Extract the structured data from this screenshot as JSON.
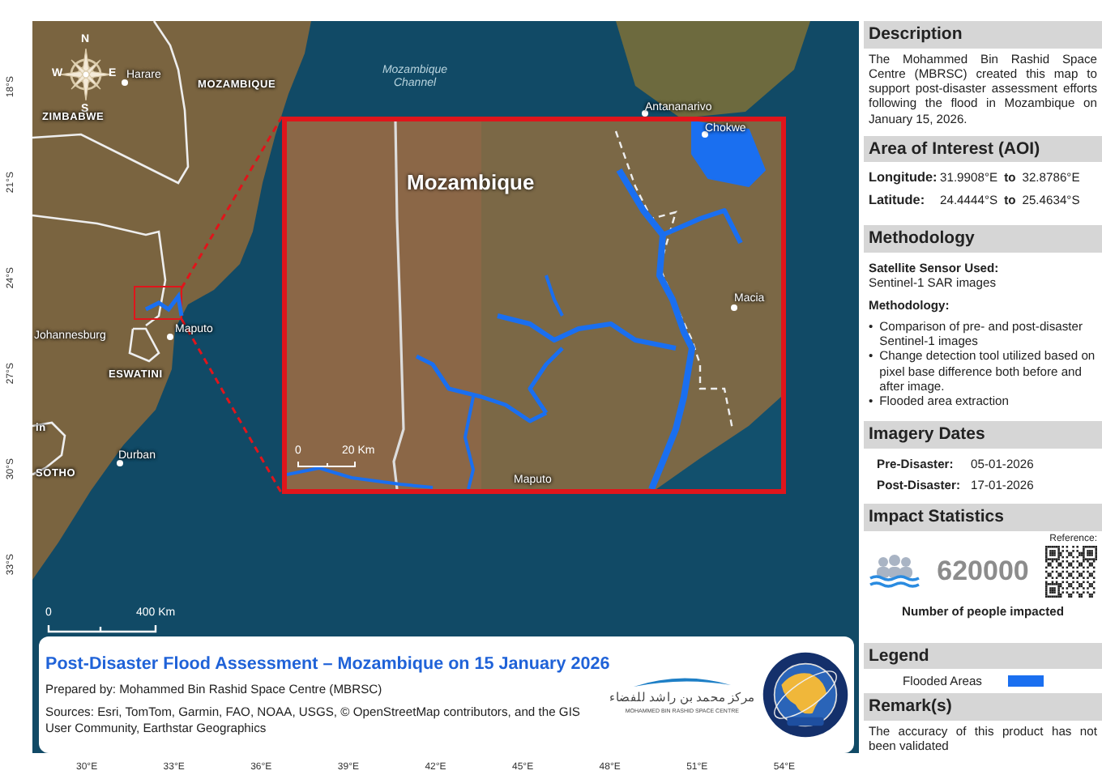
{
  "map": {
    "compass_letters": [
      "N",
      "W",
      "E",
      "S"
    ],
    "place_labels": [
      {
        "text": "Harare",
        "kind": "city"
      },
      {
        "text": "MOZAMBIQUE",
        "kind": "country"
      },
      {
        "text": "ZIMBABWE",
        "kind": "country"
      },
      {
        "text": "Mozambique Channel",
        "kind": "sea"
      },
      {
        "text": "Antananarivo",
        "kind": "city"
      },
      {
        "text": "Johannesburg",
        "kind": "city"
      },
      {
        "text": "Maputo",
        "kind": "city"
      },
      {
        "text": "ESWATINI",
        "kind": "country"
      },
      {
        "text": "in",
        "kind": "country"
      },
      {
        "text": "Durban",
        "kind": "city"
      },
      {
        "text": "SOTHO",
        "kind": "country"
      }
    ],
    "lat_ticks": [
      "18°S",
      "21°S",
      "24°S",
      "27°S",
      "30°S",
      "33°S"
    ],
    "lon_ticks": [
      "30°E",
      "33°E",
      "36°E",
      "39°E",
      "42°E",
      "45°E",
      "48°E",
      "51°E",
      "54°E"
    ],
    "scale_bar": {
      "start": "0",
      "end": "400 Km"
    },
    "inset": {
      "title": "Mozambique",
      "place_labels": [
        {
          "text": "Chokwe",
          "kind": "city"
        },
        {
          "text": "Macia",
          "kind": "city"
        },
        {
          "text": "Maputo",
          "kind": "city"
        }
      ],
      "scale_bar": {
        "start": "0",
        "end": "20 Km"
      }
    }
  },
  "title_box": {
    "title": "Post-Disaster Flood Assessment – Mozambique on 15 January 2026",
    "prepared_by": "Prepared by: Mohammed Bin Rashid Space Centre (MBRSC)",
    "sources": "Sources: Esri, TomTom, Garmin, FAO, NOAA, USGS, © OpenStreetMap contributors, and the GIS User Community, Earthstar Geographics",
    "logo_arabic": "مركز محمد بن راشد للفضاء",
    "logo_english": "MOHAMMED BIN RASHID SPACE CENTRE"
  },
  "panel": {
    "sections": [
      {
        "kind": "text",
        "header": "Description",
        "text": "The Mohammed Bin Rashid Space Centre (MBRSC) created this map to support post-disaster assessment efforts following the flood in Mozambique on January 15, 2026."
      },
      {
        "kind": "ranges",
        "header": "Area of Interest (AOI)",
        "rows": [
          {
            "label": "Longitude:",
            "from": "31.9908°E",
            "joiner": "to",
            "to": "32.8786°E"
          },
          {
            "label": "Latitude:",
            "from": "24.4444°S",
            "joiner": "to",
            "to": "25.4634°S"
          }
        ]
      },
      {
        "kind": "method",
        "header": "Methodology",
        "sensor_label": "Satellite Sensor Used:",
        "sensor": "Sentinel-1 SAR images",
        "method_label": "Methodology:",
        "bullets": [
          {
            "mark": "•",
            "text": "Comparison of pre- and post-disaster Sentinel-1  images"
          },
          {
            "mark": "•",
            "text": "Change detection tool utilized based on pixel base difference both before and after image."
          },
          {
            "mark": "•",
            "text": "Flooded area extraction"
          }
        ]
      },
      {
        "kind": "dates",
        "header": "Imagery Dates",
        "rows": [
          {
            "label": "Pre-Disaster:",
            "value": "05-01-2026"
          },
          {
            "label": "Post-Disaster:",
            "value": "17-01-2026"
          }
        ]
      },
      {
        "kind": "impact",
        "header": "Impact Statistics",
        "reference_label": "Reference:",
        "count": "620000",
        "caption": "Number of people impacted"
      },
      {
        "kind": "legend",
        "header": "Legend",
        "items": [
          {
            "label": "Flooded Areas",
            "color": "#1a6ff0"
          }
        ]
      },
      {
        "kind": "text",
        "header": "Remark(s)",
        "text": "The accuracy of this product has not been validated"
      }
    ]
  }
}
